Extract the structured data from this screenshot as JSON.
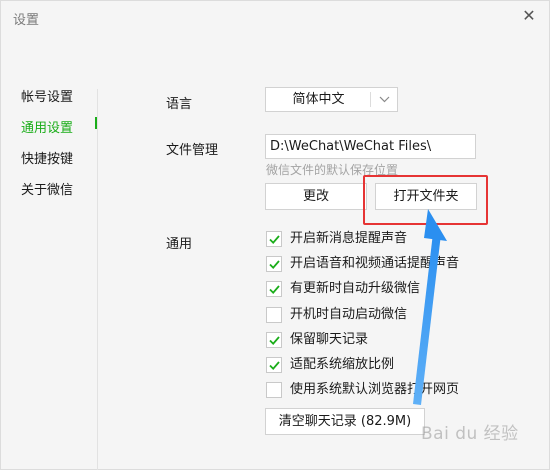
{
  "window": {
    "title": "设置",
    "close_glyph": "✕"
  },
  "nav": {
    "items": [
      {
        "label": "帐号设置",
        "active": false
      },
      {
        "label": "通用设置",
        "active": true
      },
      {
        "label": "快捷按键",
        "active": false
      },
      {
        "label": "关于微信",
        "active": false
      }
    ]
  },
  "language": {
    "label": "语言",
    "value": "简体中文",
    "dropdown_icon": "chevron-down-icon"
  },
  "file_management": {
    "label": "文件管理",
    "path": "D:\\WeChat\\WeChat Files\\",
    "hint": "微信文件的默认保存位置",
    "change_label": "更改",
    "open_folder_label": "打开文件夹"
  },
  "general": {
    "label": "通用",
    "options": [
      {
        "label": "开启新消息提醒声音",
        "checked": true
      },
      {
        "label": "开启语音和视频通话提醒声音",
        "checked": true
      },
      {
        "label": "有更新时自动升级微信",
        "checked": true
      },
      {
        "label": "开机时自动启动微信",
        "checked": false
      },
      {
        "label": "保留聊天记录",
        "checked": true
      },
      {
        "label": "适配系统缩放比例",
        "checked": true
      },
      {
        "label": "使用系统默认浏览器打开网页",
        "checked": false
      }
    ],
    "clear_history_label": "清空聊天记录 (82.9M)"
  },
  "colors": {
    "accent_green": "#1aad19",
    "annotation_red": "#e63434",
    "annotation_arrow_blue": "#2b8ff0"
  },
  "watermark": "Bai du 经验"
}
